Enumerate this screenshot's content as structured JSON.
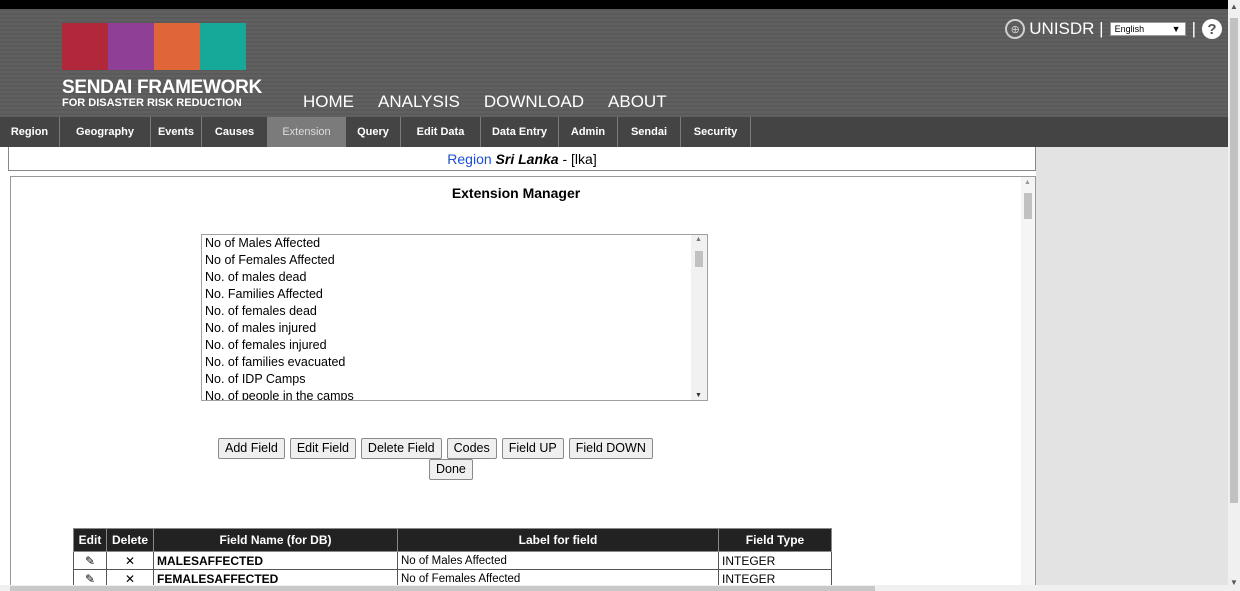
{
  "brand": {
    "squares": [
      "#b0283a",
      "#8f3f95",
      "#e0663a",
      "#16a99a"
    ],
    "line1": "SENDAI FRAMEWORK",
    "line2": "FOR DISASTER RISK REDUCTION"
  },
  "main_nav": [
    "HOME",
    "ANALYSIS",
    "DOWNLOAD",
    "ABOUT"
  ],
  "top_right": {
    "org": "UNISDR |",
    "language": "English",
    "separator": "|"
  },
  "tabs": [
    "Region",
    "Geography",
    "Events",
    "Causes",
    "Extension",
    "Query",
    "Edit Data",
    "Data Entry",
    "Admin",
    "Sendai",
    "Security"
  ],
  "active_tab": "Extension",
  "region": {
    "label": "Region",
    "name": "Sri Lanka",
    "dash": "-",
    "code": "[lka]"
  },
  "manager_title": "Extension Manager",
  "fields_list": [
    "No of Males Affected",
    "No of Females Affected",
    "No. of males dead",
    "No. Families Affected",
    "No. of females dead",
    "No. of males injured",
    "No. of females injured",
    "No. of families evacuated",
    "No. of IDP Camps",
    "No. of people in the camps"
  ],
  "buttons": {
    "add": "Add Field",
    "edit": "Edit Field",
    "delete": "Delete Field",
    "codes": "Codes",
    "up": "Field UP",
    "down": "Field DOWN",
    "done": "Done"
  },
  "table": {
    "headers": [
      "Edit",
      "Delete",
      "Field Name (for DB)",
      "Label for field",
      "Field Type"
    ],
    "rows": [
      {
        "field": "MALESAFFECTED",
        "label": "No of Males Affected",
        "type": "INTEGER"
      },
      {
        "field": "FEMALESAFFECTED",
        "label": "No of Females Affected",
        "type": "INTEGER"
      }
    ]
  }
}
